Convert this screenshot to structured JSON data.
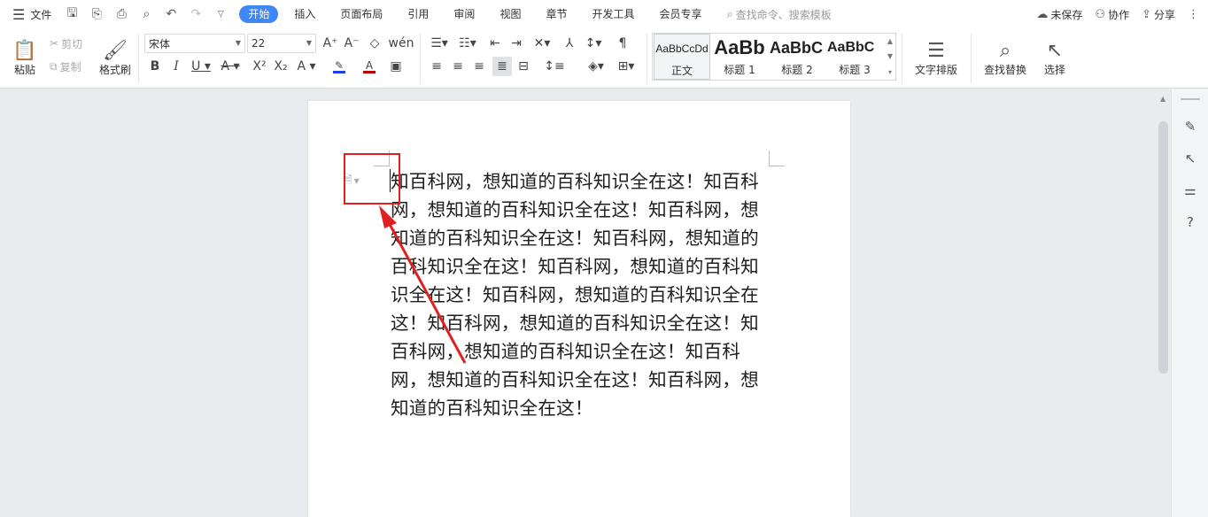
{
  "menubar": {
    "file_label": "文件",
    "tabs": [
      "开始",
      "插入",
      "页面布局",
      "引用",
      "审阅",
      "视图",
      "章节",
      "开发工具",
      "会员专享"
    ],
    "search_placeholder": "查找命令、搜索模板",
    "unsaved_label": "未保存",
    "collab_label": "协作",
    "share_label": "分享"
  },
  "ribbon": {
    "paste_label": "粘贴",
    "cut_label": "剪切",
    "copy_label": "复制",
    "format_painter_label": "格式刷",
    "font_name": "宋体",
    "font_size": "22",
    "styles": [
      {
        "preview": "AaBbCcDd",
        "name": "正文"
      },
      {
        "preview": "AaBb",
        "name": "标题 1"
      },
      {
        "preview": "AaBbC",
        "name": "标题 2"
      },
      {
        "preview": "AaBbC",
        "name": "标题 3"
      }
    ],
    "text_layout_label": "文字排版",
    "find_replace_label": "查找替换",
    "select_label": "选择"
  },
  "document": {
    "text": "知百科网，想知道的百科知识全在这！知百科网，想知道的百科知识全在这！知百科网，想知道的百科知识全在这！知百科网，想知道的百科知识全在这！知百科网，想知道的百科知识全在这！知百科网，想知道的百科知识全在这！知百科网，想知道的百科知识全在这！知百科网，想知道的百科知识全在这！知百科网，想知道的百科知识全在这！知百科网，想知道的百科知识全在这！"
  },
  "colors": {
    "accent": "#3f86f6",
    "annotation": "#e02020",
    "highlight_bar": "#1d3df0",
    "font_color_bar": "#c00000"
  }
}
